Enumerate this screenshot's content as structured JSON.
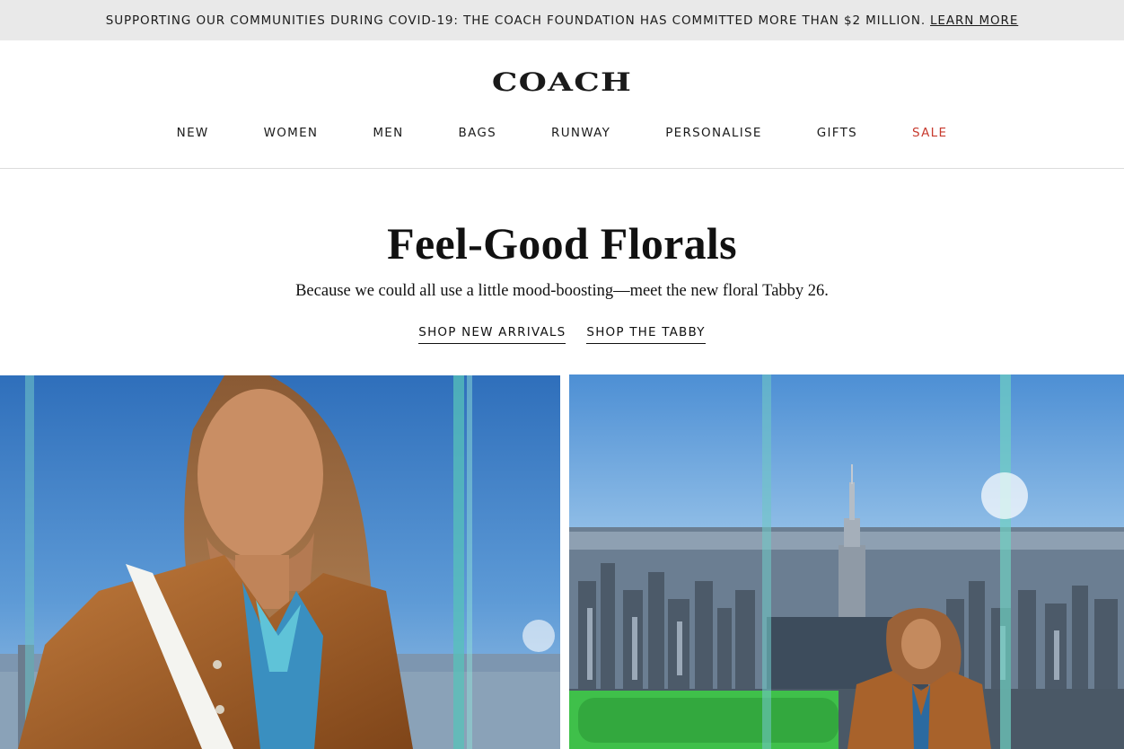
{
  "promo": {
    "text": "SUPPORTING OUR COMMUNITIES DURING COVID-19: THE COACH FOUNDATION HAS COMMITTED MORE THAN $2 MILLION.",
    "link": "LEARN MORE"
  },
  "header": {
    "logo": "COACH",
    "nav": [
      "NEW",
      "WOMEN",
      "MEN",
      "BAGS",
      "RUNWAY",
      "PERSONALISE",
      "GIFTS",
      "SALE"
    ]
  },
  "hero": {
    "title": "Feel-Good Florals",
    "subtitle": "Because we could all use a little mood-boosting—meet the new floral Tabby 26.",
    "cta_new": "SHOP NEW ARRIVALS",
    "cta_tabby": "SHOP THE TABBY"
  },
  "colors": {
    "promo_bg": "#e9e9e9",
    "sale": "#c73a2e",
    "sky": "#3e7fc4",
    "jacket": "#a8622b"
  }
}
